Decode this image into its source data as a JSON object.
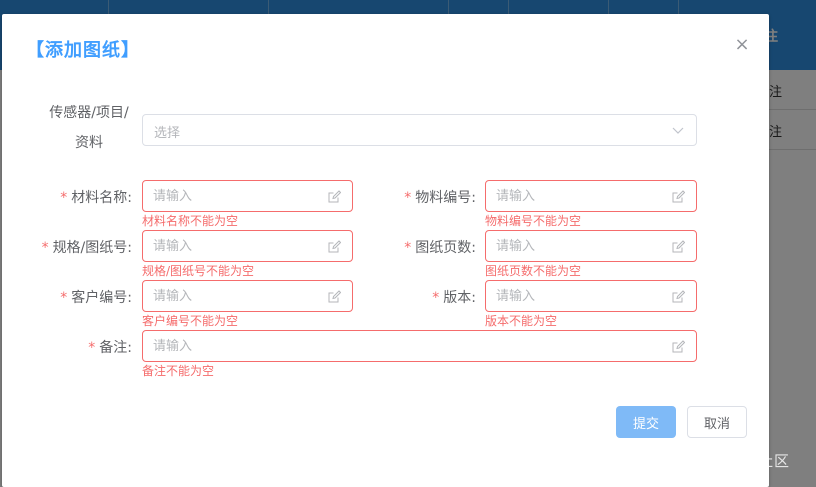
{
  "background": {
    "header_text": "注",
    "row_texts": [
      "注",
      "注"
    ]
  },
  "dialog": {
    "title": "【添加图纸】",
    "close_symbol": "×"
  },
  "form": {
    "source": {
      "label_line1": "传感器/项目/",
      "label_line2": "资料",
      "placeholder": "选择"
    },
    "material_name": {
      "label": "材料名称:",
      "placeholder": "请输入",
      "error": "材料名称不能为空"
    },
    "material_code": {
      "label": "物料编号:",
      "placeholder": "请输入",
      "error": "物料编号不能为空"
    },
    "spec_drawing_no": {
      "label": "规格/图纸号:",
      "placeholder": "请输入",
      "error": "规格/图纸号不能为空"
    },
    "drawing_pages": {
      "label": "图纸页数:",
      "placeholder": "请输入",
      "error": "图纸页数不能为空"
    },
    "customer_code": {
      "label": "客户编号:",
      "placeholder": "请输入",
      "error": "客户编号不能为空"
    },
    "version": {
      "label": "版本:",
      "placeholder": "请输入",
      "error": "版本不能为空"
    },
    "remark": {
      "label": "备注:",
      "placeholder": "请输入",
      "error": "备注不能为空"
    },
    "required_mark": "*"
  },
  "footer": {
    "submit_label": "提交",
    "cancel_label": "取消"
  },
  "watermark": "@稀土掘金技术社区",
  "colors": {
    "primary": "#409eff",
    "error": "#f56c6c",
    "submit_disabled": "#7fbaf7"
  }
}
